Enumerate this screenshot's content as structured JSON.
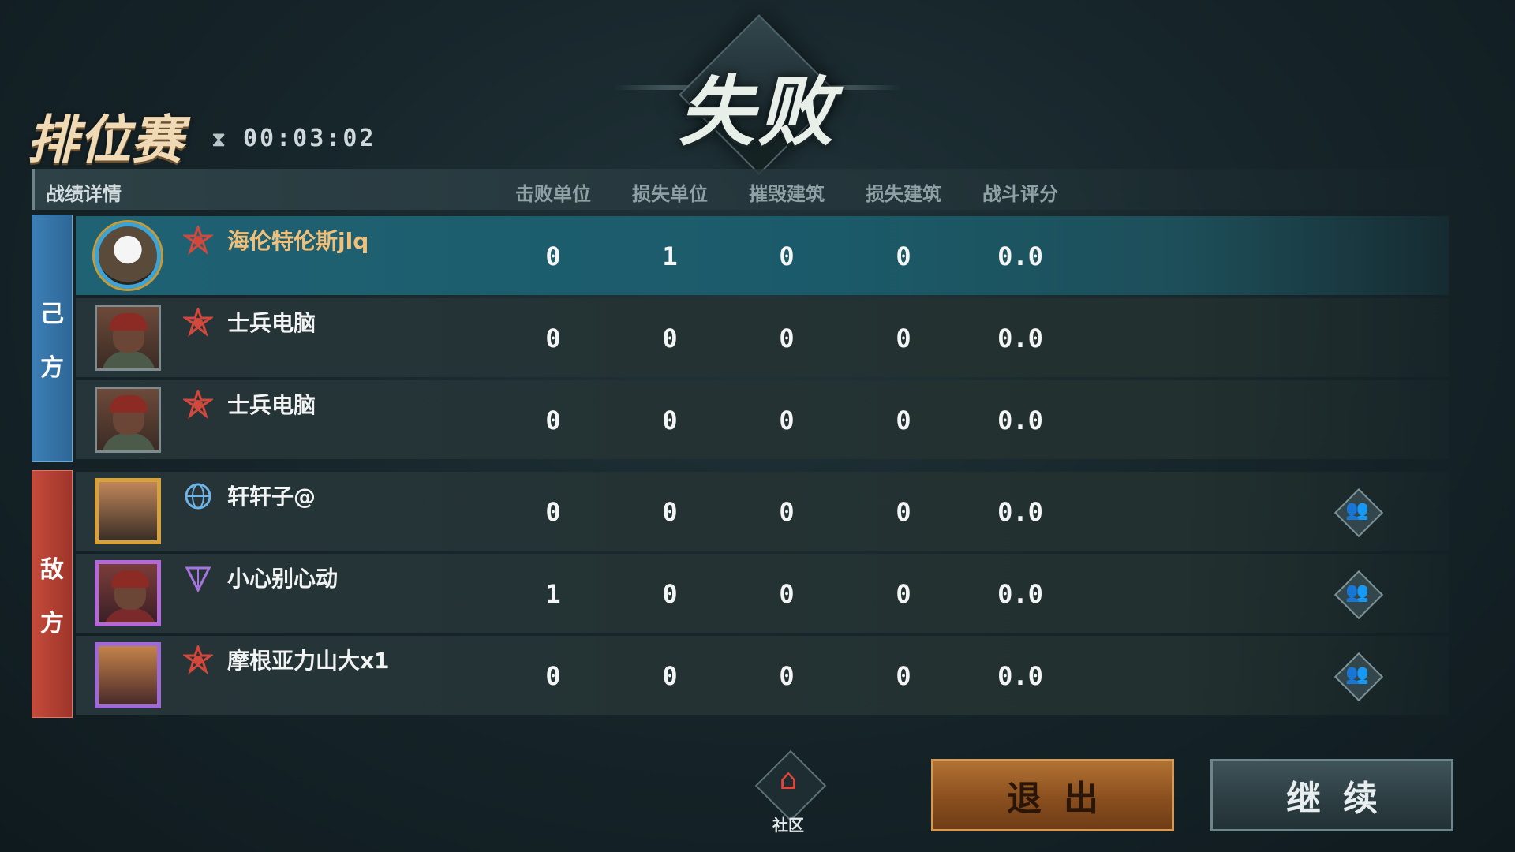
{
  "result_title": "失败",
  "mode": "排位赛",
  "timer": "00:03:02",
  "table": {
    "header_label": "战绩详情",
    "columns": [
      "击败单位",
      "损失单位",
      "摧毁建筑",
      "损失建筑",
      "战斗评分"
    ]
  },
  "sides": {
    "ally": [
      "己",
      "方"
    ],
    "enemy": [
      "敌",
      "方"
    ]
  },
  "players": [
    {
      "name": "海伦特伦斯jlq",
      "avatar": "eagle-avatar",
      "rank_icon": "red-rank-icon",
      "stats": [
        "0",
        "1",
        "0",
        "0",
        "0.0"
      ],
      "side": "ally",
      "is_self": true
    },
    {
      "name": "士兵电脑",
      "avatar": "soldier-avatar",
      "rank_icon": "red-rank-icon",
      "stats": [
        "0",
        "0",
        "0",
        "0",
        "0.0"
      ],
      "side": "ally"
    },
    {
      "name": "士兵电脑",
      "avatar": "soldier-avatar",
      "rank_icon": "red-rank-icon",
      "stats": [
        "0",
        "0",
        "0",
        "0",
        "0.0"
      ],
      "side": "ally"
    },
    {
      "name": "轩轩子@",
      "avatar": "gold-frame-avatar",
      "rank_icon": "globe-rank-icon",
      "stats": [
        "0",
        "0",
        "0",
        "0",
        "0.0"
      ],
      "side": "enemy",
      "add_friend": true
    },
    {
      "name": "小心别心动",
      "avatar": "purple-frame-avatar",
      "rank_icon": "purple-rank-icon",
      "stats": [
        "1",
        "0",
        "0",
        "0",
        "0.0"
      ],
      "side": "enemy",
      "add_friend": true
    },
    {
      "name": "摩根亚力山大x1",
      "avatar": "dragon-avatar",
      "rank_icon": "red-rank-icon",
      "stats": [
        "0",
        "0",
        "0",
        "0",
        "0.0"
      ],
      "side": "enemy",
      "add_friend": true
    }
  ],
  "bottom": {
    "community_label": "社区",
    "exit_label": "退出",
    "continue_label": "继续"
  },
  "colors": {
    "ally": "#3c7fb6",
    "enemy": "#c54b3c",
    "self_row": "#1f6274",
    "self_name": "#f0c07a"
  }
}
